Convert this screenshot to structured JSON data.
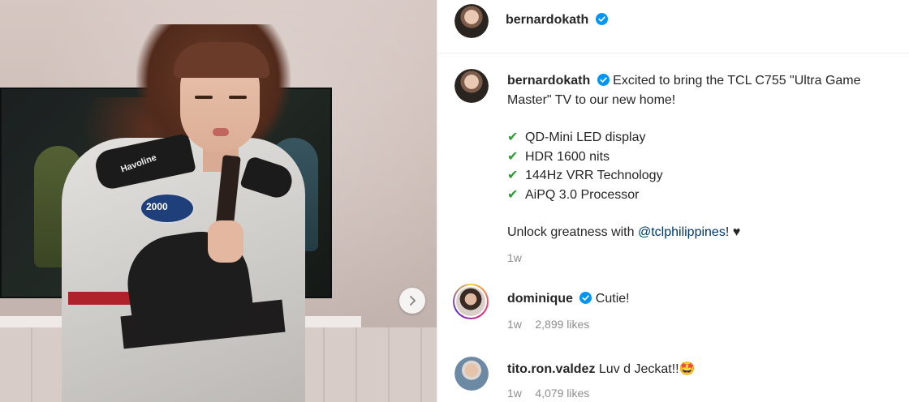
{
  "post": {
    "author": "bernardokath",
    "caption_line1": "Excited to bring the TCL C755 \"Ultra Game Master\" TV to our new home!",
    "features": [
      "QD-Mini LED display",
      "HDR 1600 nits",
      "144Hz VRR Technology",
      "AiPQ 3.0 Processor"
    ],
    "unlock_text": "Unlock greatness with",
    "mention": "@tclphilippines",
    "unlock_suffix": "!",
    "heart": "♥",
    "check_glyph": "✔",
    "age": "1w"
  },
  "media": {
    "jacket_badge_text": "Havoline",
    "patch_text": "2000",
    "next_icon": "chevron-right-icon"
  },
  "comments": [
    {
      "username": "dominique",
      "verified": true,
      "text": "Cutie!",
      "age": "1w",
      "likes": "2,899 likes"
    },
    {
      "username": "tito.ron.valdez",
      "verified": false,
      "text": "Luv d Jeckat!!🤩",
      "age": "1w",
      "likes": "4,079 likes"
    }
  ],
  "colors": {
    "verified_blue": "#0095f6",
    "check_green": "#2e9b33",
    "mention_link": "#00376b"
  }
}
